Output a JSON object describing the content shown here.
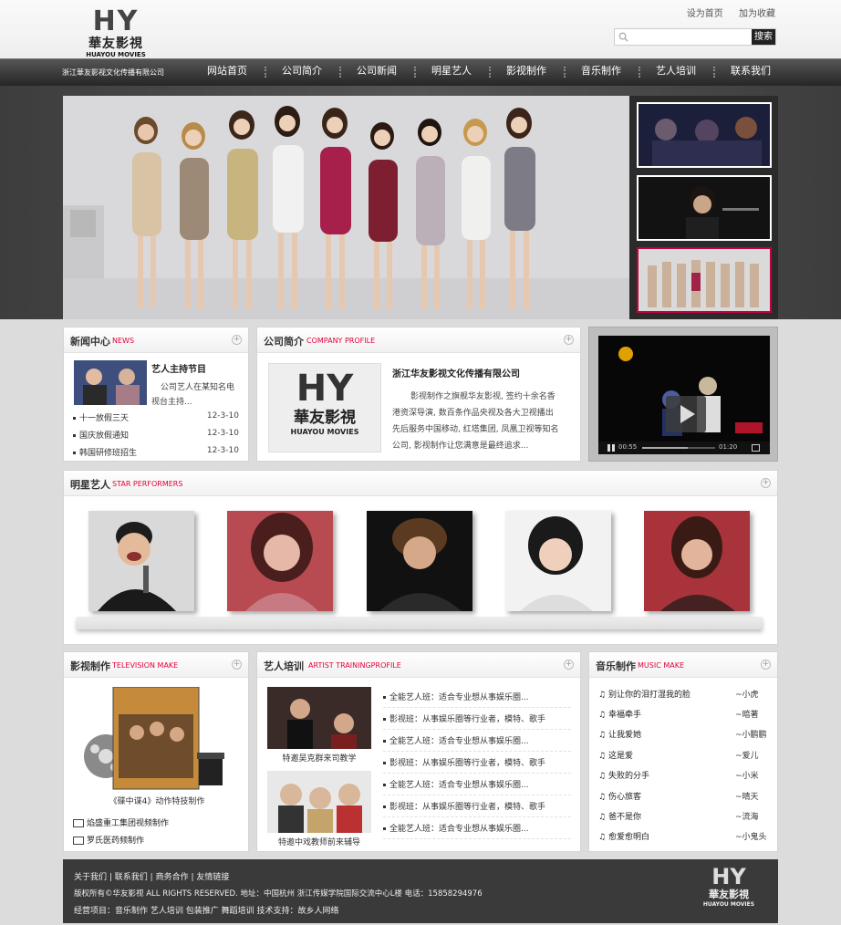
{
  "logo": {
    "letters": "HY",
    "cn": "華友影視",
    "en": "HUAYOU MOVIES",
    "company": "浙江華友影视文化传播有限公司"
  },
  "top_links": {
    "set_home": "设为首页",
    "favorite": "加为收藏"
  },
  "search": {
    "placeholder": "",
    "button": "搜索"
  },
  "nav": [
    "网站首页",
    "公司简介",
    "公司新闻",
    "明星艺人",
    "影视制作",
    "音乐制作",
    "艺人培训",
    "联系我们"
  ],
  "news": {
    "title": "新闻中心",
    "en": "NEWS",
    "featured_title": "艺人主持节目",
    "featured_text_1": "公司艺人在某知名电",
    "featured_text_2": "视台主持...",
    "items": [
      {
        "title": "十一放假三天",
        "date": "12-3-10"
      },
      {
        "title": "国庆放假通知",
        "date": "12-3-10"
      },
      {
        "title": "韩国研修班招生",
        "date": "12-3-10"
      }
    ]
  },
  "company": {
    "title": "公司简介",
    "en": "COMPANY PROFILE",
    "name": "浙江华友影视文化传播有限公司",
    "lines": [
      "影视制作之旗舰华友影视, 签约十余名香",
      "港资深导演, 数百条作品央视及各大卫视播出",
      "先后服务中国移动, 红塔集团, 凤凰卫视等知名",
      "公司, 影视制作让您满意是最终追求..."
    ],
    "logo_letters": "HY",
    "logo_cn": "華友影視",
    "logo_en": "HUAYOU MOVIES"
  },
  "video": {
    "time_current": "00:55",
    "time_total": "01:20"
  },
  "stars": {
    "title": "明星艺人",
    "en": "STAR PERFORMERS"
  },
  "tv": {
    "title": "影视制作",
    "en": "TELEVISION MAKE",
    "poster_caption": "《碟中谍4》动作特技制作",
    "items": [
      "焰盛重工集团视频制作",
      "罗氏医药频制作"
    ]
  },
  "training": {
    "title": "艺人培训",
    "en": "ARTIST TRAININGPROFILE",
    "photo1_caption": "特邀吴克群来司教学",
    "photo2_caption": "特邀中戏教师前来辅导",
    "items": [
      "全能艺人班：适合专业想从事娱乐圈...",
      "影视班：从事娱乐圈等行业者，模特、歌手",
      "全能艺人班：适合专业想从事娱乐圈...",
      "影视班：从事娱乐圈等行业者，模特、歌手",
      "全能艺人班：适合专业想从事娱乐圈...",
      "影视班：从事娱乐圈等行业者，模特、歌手",
      "全能艺人班：适合专业想从事娱乐圈..."
    ]
  },
  "music": {
    "title": "音乐制作",
    "en": "MUSIC MAKE",
    "songs": [
      {
        "title": "别让你的泪打湿我的脸",
        "artist": "~小虎"
      },
      {
        "title": "幸福牵手",
        "artist": "~暗著"
      },
      {
        "title": "让我爱她",
        "artist": "~小鹏鹏"
      },
      {
        "title": "这是爱",
        "artist": "~爱儿"
      },
      {
        "title": "失败的分手",
        "artist": "~小米"
      },
      {
        "title": "伤心旅客",
        "artist": "~晴天"
      },
      {
        "title": "爸不是你",
        "artist": "~流海"
      },
      {
        "title": "愈爱愈明白",
        "artist": "~小鬼头"
      }
    ]
  },
  "footer": {
    "links": [
      "关于我们",
      "联系我们",
      "商务合作",
      "友情链接"
    ],
    "line2": "版权所有©华友影视 ALL RIGHTS RESERVED. 地址：中国杭州 浙江传媒学院国际交流中心L楼  电话：15858294976",
    "line3": "经营项目：音乐制作 艺人培训 包装推广 舞蹈培训  技术支持：故乡人网络",
    "logo_letters": "HY",
    "logo_cn": "華友影視",
    "logo_en": "HUAYOU MOVIES"
  },
  "colors": {
    "accent": "#e2003a",
    "nav_bg": "#333333",
    "banner_bg": "#444444"
  }
}
